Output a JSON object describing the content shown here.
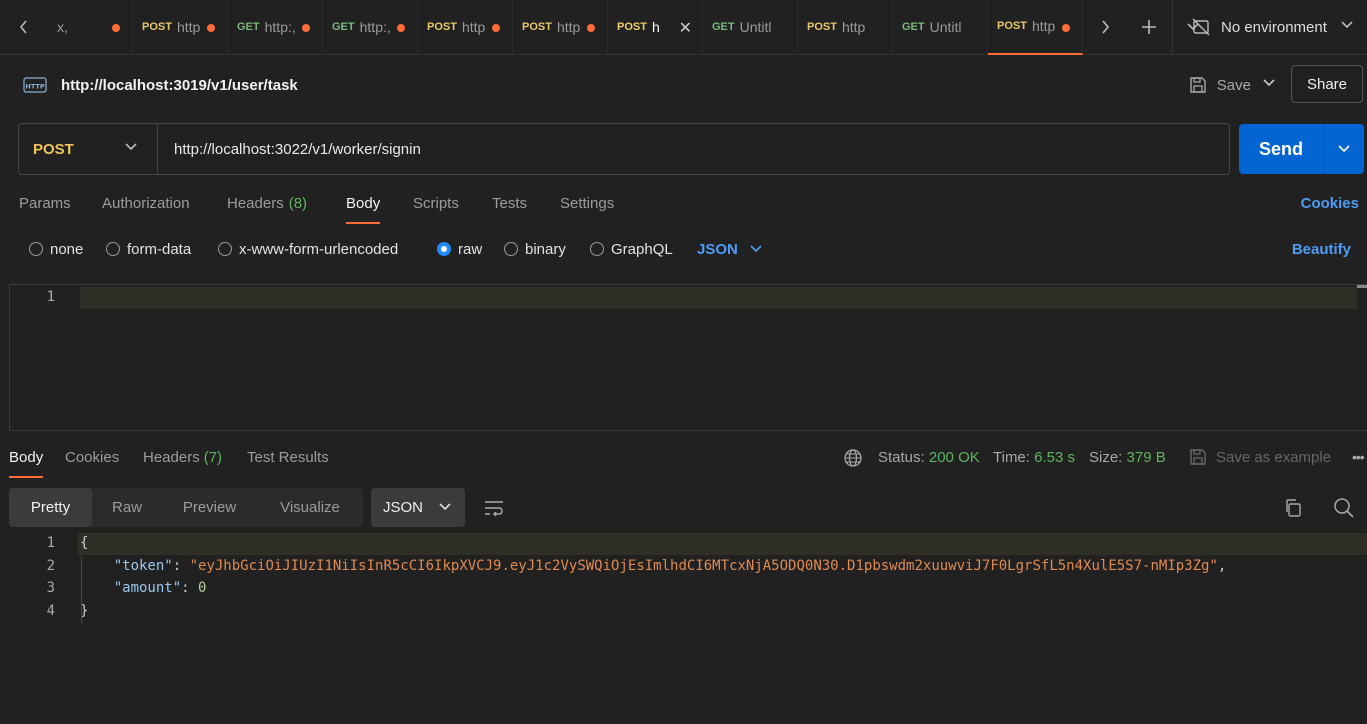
{
  "tabbar": {
    "tabs": [
      {
        "method": "",
        "name": "x,",
        "dot": true
      },
      {
        "method": "POST",
        "name": "http",
        "dot": true
      },
      {
        "method": "GET",
        "name": "http:,",
        "dot": true
      },
      {
        "method": "GET",
        "name": "http:,",
        "dot": true
      },
      {
        "method": "POST",
        "name": "http",
        "dot": true
      },
      {
        "method": "POST",
        "name": "http",
        "dot": true
      },
      {
        "method": "POST",
        "name": "h",
        "close": true
      },
      {
        "method": "GET",
        "name": "Untitl",
        "dot": false
      },
      {
        "method": "POST",
        "name": "http",
        "dot": false
      },
      {
        "method": "GET",
        "name": "Untitl",
        "dot": false
      },
      {
        "method": "POST",
        "name": "http",
        "dot": true,
        "active": true
      }
    ],
    "environment": "No environment"
  },
  "request": {
    "title": "http://localhost:3019/v1/user/task",
    "save_label": "Save",
    "share_label": "Share",
    "method": "POST",
    "url": "http://localhost:3022/v1/worker/signin",
    "send_label": "Send"
  },
  "request_tabs": {
    "params": "Params",
    "authorization": "Authorization",
    "headers": "Headers",
    "headers_count": "(8)",
    "body": "Body",
    "scripts": "Scripts",
    "tests": "Tests",
    "settings": "Settings",
    "cookies": "Cookies"
  },
  "body_types": {
    "none": "none",
    "form_data": "form-data",
    "urlencoded": "x-www-form-urlencoded",
    "raw": "raw",
    "binary": "binary",
    "graphql": "GraphQL",
    "format": "JSON",
    "beautify": "Beautify",
    "selected": "raw"
  },
  "editor": {
    "line_numbers": [
      "1"
    ]
  },
  "response": {
    "tabs": {
      "body": "Body",
      "cookies": "Cookies",
      "headers": "Headers",
      "headers_count": "(7)",
      "test_results": "Test Results"
    },
    "status_label": "Status:",
    "status_value": "200 OK",
    "time_label": "Time:",
    "time_value": "6.53 s",
    "size_label": "Size:",
    "size_value": "379 B",
    "save_example": "Save as example",
    "view_modes": {
      "pretty": "Pretty",
      "raw": "Raw",
      "preview": "Preview",
      "visualize": "Visualize"
    },
    "format": "JSON",
    "lines": {
      "n1": "1",
      "n2": "2",
      "n3": "3",
      "n4": "4",
      "open": "{",
      "token_key": "\"token\"",
      "token_value": "\"eyJhbGciOiJIUzI1NiIsInR5cCI6IkpXVCJ9.eyJ1c2VySWQiOjEsImlhdCI6MTcxNjA5ODQ0N30.D1pbswdm2xuuwviJ7F0LgrSfL5n4XulE5S7-nMIp3Zg\"",
      "amount_key": "\"amount\"",
      "amount_value": "0",
      "close": "}"
    }
  },
  "colors": {
    "accent": "#ff6c37",
    "send": "#0265d2",
    "link": "#4f9cf7",
    "success": "#5fb55f"
  }
}
